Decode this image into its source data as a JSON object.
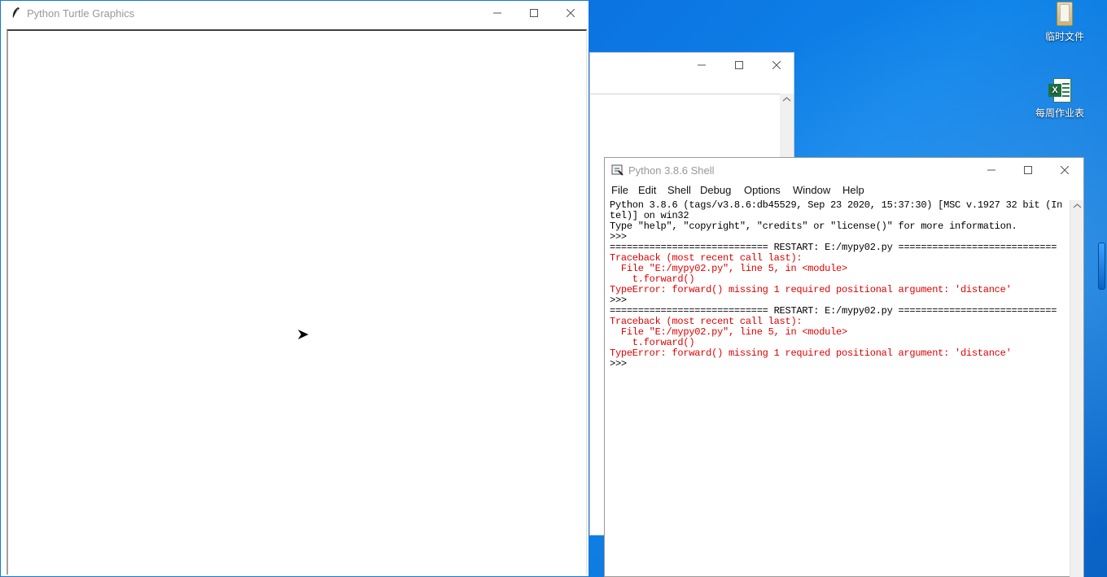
{
  "desktop": {
    "icons": [
      {
        "label": "临时文件",
        "icon": "folder-icon"
      },
      {
        "label": "每周作业表",
        "icon": "excel-file-icon"
      }
    ]
  },
  "turtle_window": {
    "title": "Python Turtle Graphics",
    "controls": {
      "minimize": "minimize-icon",
      "maximize": "maximize-icon",
      "close": "close-icon"
    }
  },
  "shell_window": {
    "title": "Python 3.8.6 Shell",
    "menu": [
      "File",
      "Edit",
      "Shell",
      "Debug",
      "Options",
      "Window",
      "Help"
    ],
    "lines": [
      {
        "text": "Python 3.8.6 (tags/v3.8.6:db45529, Sep 23 2020, 15:37:30) [MSC v.1927 32 bit (In",
        "kind": "normal"
      },
      {
        "text": "tel)] on win32",
        "kind": "normal"
      },
      {
        "text": "Type \"help\", \"copyright\", \"credits\" or \"license()\" for more information.",
        "kind": "normal"
      },
      {
        "text": ">>> ",
        "kind": "normal"
      },
      {
        "text": "============================ RESTART: E:/mypy02.py ============================",
        "kind": "normal"
      },
      {
        "text": "Traceback (most recent call last):",
        "kind": "err"
      },
      {
        "text": "  File \"E:/mypy02.py\", line 5, in <module>",
        "kind": "err"
      },
      {
        "text": "    t.forward()",
        "kind": "err"
      },
      {
        "text": "TypeError: forward() missing 1 required positional argument: 'distance'",
        "kind": "err"
      },
      {
        "text": ">>> ",
        "kind": "normal"
      },
      {
        "text": "============================ RESTART: E:/mypy02.py ============================",
        "kind": "normal"
      },
      {
        "text": "Traceback (most recent call last):",
        "kind": "err"
      },
      {
        "text": "  File \"E:/mypy02.py\", line 5, in <module>",
        "kind": "err"
      },
      {
        "text": "    t.forward()",
        "kind": "err"
      },
      {
        "text": "TypeError: forward() missing 1 required positional argument: 'distance'",
        "kind": "err"
      },
      {
        "text": ">>> ",
        "kind": "normal"
      }
    ]
  },
  "colors": {
    "error_text": "#e00000",
    "desktop_blue": "#0b73e0"
  }
}
